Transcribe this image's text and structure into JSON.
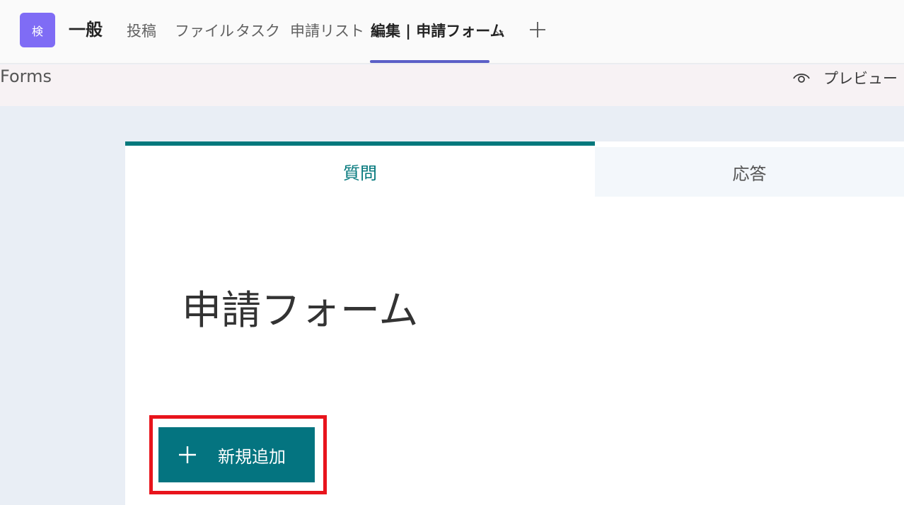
{
  "header": {
    "team_avatar": "検",
    "channel_name": "一般",
    "tabs": [
      {
        "label": "投稿"
      },
      {
        "label": "ファイル"
      },
      {
        "label": "タスク"
      },
      {
        "label": "申請リスト"
      },
      {
        "label": "編集 | 申請フォーム"
      }
    ],
    "active_tab_index": 4,
    "icons": {
      "chevron": "chevron-down-icon",
      "add": "plus-icon"
    }
  },
  "forms_bar": {
    "app_name": "Forms",
    "preview_label": "プレビュー",
    "preview_icon": "eye-icon"
  },
  "form": {
    "tabs": {
      "questions": "質問",
      "responses": "応答"
    },
    "title": "申請フォーム",
    "add_new_label": "新規追加",
    "add_icon": "plus-icon"
  },
  "colors": {
    "accent_teal": "#03787c",
    "button_teal": "#047480",
    "teams_purple": "#5b5fc7",
    "avatar": "#7f6cf5",
    "highlight": "#e8141c"
  }
}
